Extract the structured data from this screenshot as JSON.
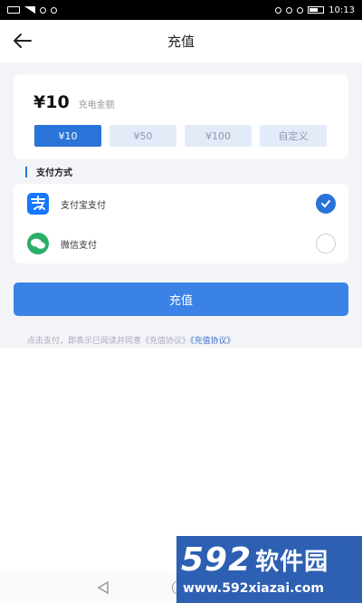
{
  "status_bar": {
    "time": "10:13"
  },
  "nav": {
    "title": "充值"
  },
  "amount": {
    "value": "¥10",
    "label": "充电金额",
    "options": [
      "¥10",
      "¥50",
      "¥100",
      "自定义"
    ],
    "selected_index": 0
  },
  "payment": {
    "section_title": "支付方式",
    "methods": [
      {
        "label": "支付宝支付",
        "icon": "alipay-icon",
        "checked": true
      },
      {
        "label": "微信支付",
        "icon": "wechat-icon",
        "checked": false
      }
    ]
  },
  "submit": {
    "label": "充值"
  },
  "agreement": {
    "text": "点击支付，即表示已阅读并同意《充值协议》",
    "link": "《充值协议》"
  },
  "watermark": {
    "brand": "592",
    "brand_cn": "软件园",
    "url": "www.592xiazai.com"
  },
  "colors": {
    "accent": "#2a73d8",
    "button": "#3a82e6",
    "alipay": "#1677ff",
    "wechat": "#2aae67"
  }
}
